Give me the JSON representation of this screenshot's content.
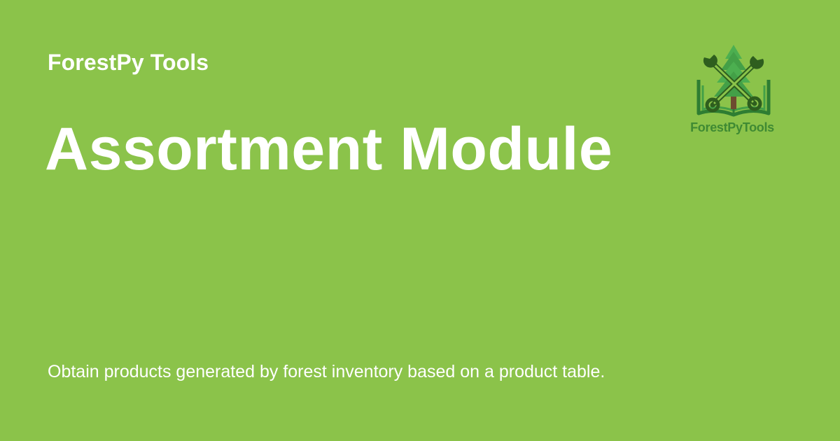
{
  "card": {
    "background_color": "#8bc34a",
    "text_color": "#ffffff"
  },
  "header": {
    "site_name": "ForestPy Tools"
  },
  "main": {
    "title": "Assortment Module",
    "description": "Obtain products generated by forest inventory based on a product table."
  },
  "logo": {
    "icon": "forestpytools-logo-icon",
    "wordmark": "ForestPyTools",
    "wordmark_color": "#3f8a33",
    "tree_color": "#4caf50",
    "book_color": "#2e7d32",
    "tools_color": "#2e5e1e"
  }
}
